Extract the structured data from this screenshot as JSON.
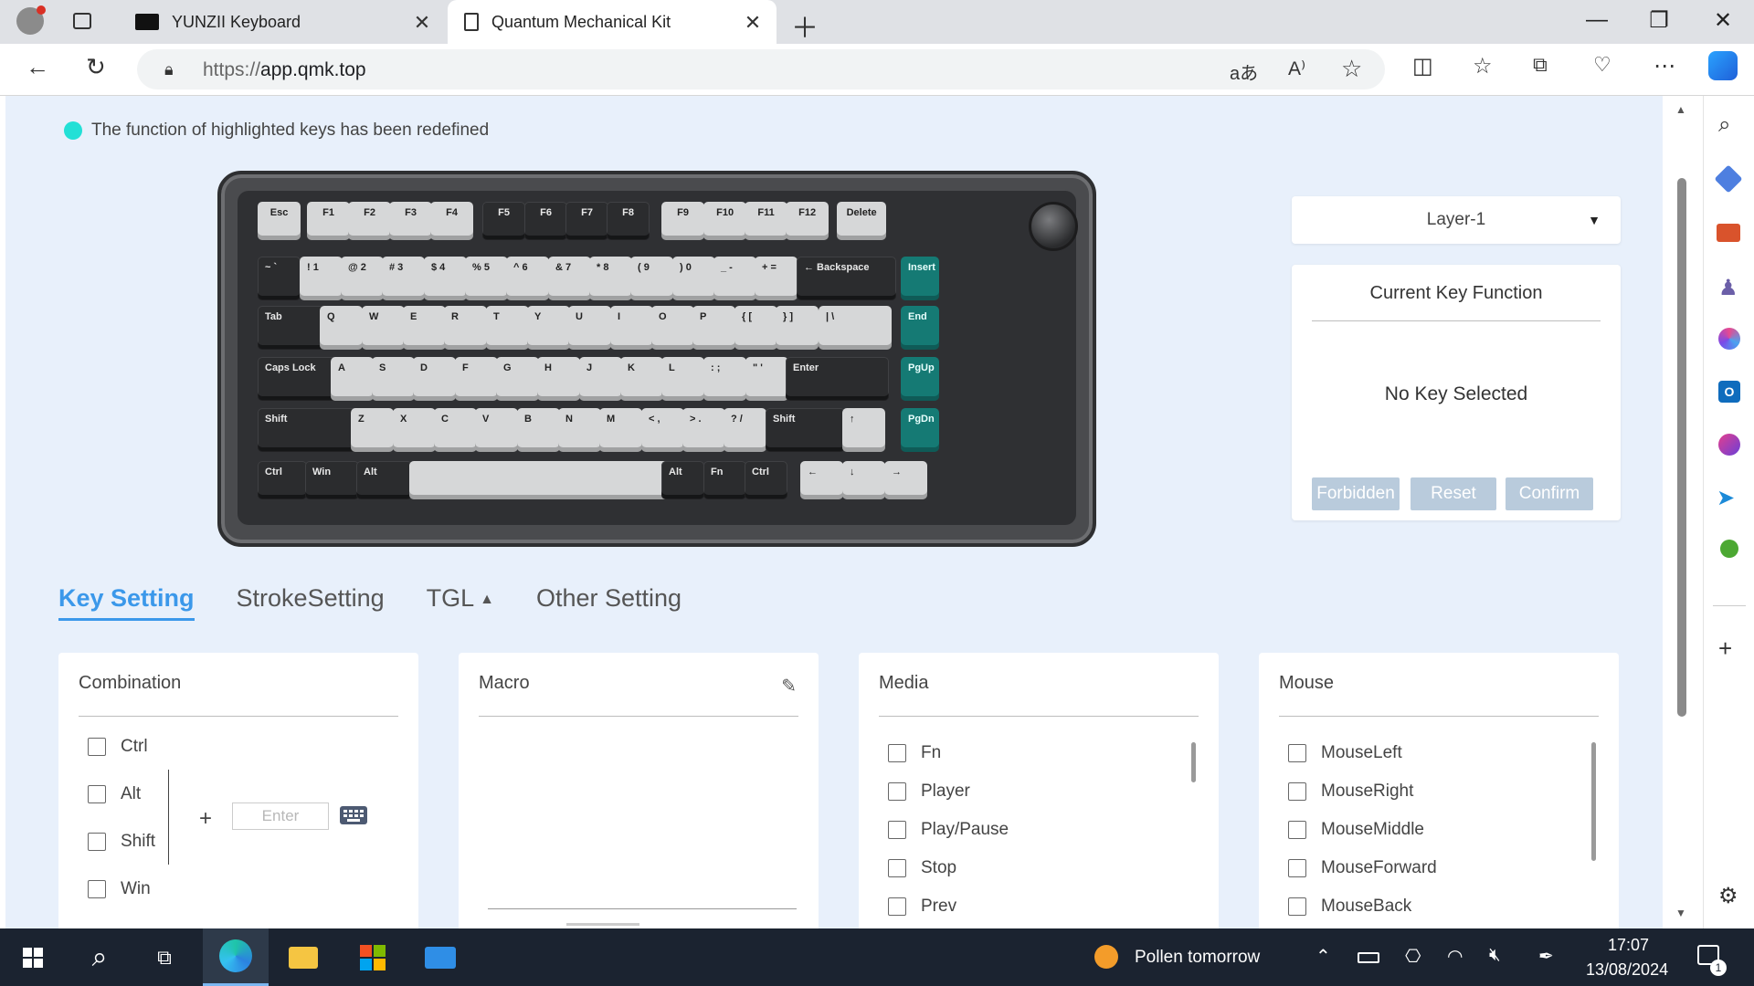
{
  "browser": {
    "tabs": [
      {
        "label": "YUNZII Keyboard",
        "active": false
      },
      {
        "label": "Quantum Mechanical Kit",
        "active": true
      }
    ],
    "url_prefix": "https://",
    "url_host": "app.qmk.top"
  },
  "page": {
    "notice": "The function of highlighted keys has been redefined",
    "highlight_color": "#22e0d6",
    "keyboard": {
      "rows": [
        [
          "Esc",
          "F1",
          "F2",
          "F3",
          "F4",
          "F5",
          "F6",
          "F7",
          "F8",
          "F9",
          "F10",
          "F11",
          "F12",
          "Delete"
        ],
        [
          "~ `",
          "! 1",
          "@ 2",
          "# 3",
          "$ 4",
          "% 5",
          "^ 6",
          "& 7",
          "* 8",
          "( 9",
          ") 0",
          "_ -",
          "+ =",
          "← Backspace",
          "Insert"
        ],
        [
          "Tab",
          "Q",
          "W",
          "E",
          "R",
          "T",
          "Y",
          "U",
          "I",
          "O",
          "P",
          "{ [",
          "} ]",
          "| \\",
          "End"
        ],
        [
          "Caps Lock",
          "A",
          "S",
          "D",
          "F",
          "G",
          "H",
          "J",
          "K",
          "L",
          ": ;",
          "\" '",
          "Enter",
          "PgUp"
        ],
        [
          "Shift",
          "Z",
          "X",
          "C",
          "V",
          "B",
          "N",
          "M",
          "< ,",
          "> .",
          "? /",
          "Shift",
          "↑",
          "PgDn"
        ],
        [
          "Ctrl",
          "Win",
          "Alt",
          "",
          "Alt",
          "Fn",
          "Ctrl",
          "←",
          "↓",
          "→"
        ]
      ]
    },
    "layer_select": {
      "value": "Layer-1"
    },
    "current_key": {
      "title": "Current Key Function",
      "status": "No Key Selected",
      "buttons": [
        "Forbidden",
        "Reset",
        "Confirm"
      ]
    },
    "setting_tabs": [
      {
        "label": "Key Setting",
        "active": true
      },
      {
        "label": "StrokeSetting",
        "active": false
      },
      {
        "label": "TGL",
        "active": false
      },
      {
        "label": "Other Setting",
        "active": false
      }
    ],
    "panels": {
      "combination": {
        "title": "Combination",
        "modifiers": [
          "Ctrl",
          "Alt",
          "Shift",
          "Win"
        ],
        "plus": "+",
        "input_placeholder": "Enter"
      },
      "macro": {
        "title": "Macro"
      },
      "media": {
        "title": "Media",
        "items": [
          "Fn",
          "Player",
          "Play/Pause",
          "Stop",
          "Prev"
        ]
      },
      "mouse": {
        "title": "Mouse",
        "items": [
          "MouseLeft",
          "MouseRight",
          "MouseMiddle",
          "MouseForward",
          "MouseBack"
        ]
      }
    }
  },
  "taskbar": {
    "weather": "Pollen tomorrow",
    "time": "17:07",
    "date": "13/08/2024",
    "notifications": "1"
  }
}
